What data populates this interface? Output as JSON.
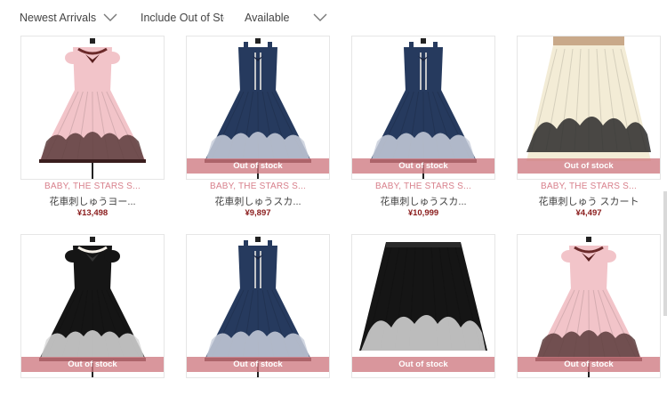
{
  "filters": [
    {
      "label": "Newest Arrivals",
      "has_chevron": true
    },
    {
      "label": "Include Out of Sto",
      "has_chevron": false
    },
    {
      "label": "Available",
      "has_chevron": true
    }
  ],
  "oos_label": "Out of stock",
  "products": [
    {
      "brand": "BABY, THE STARS S...",
      "name": "花車刺しゅうヨー...",
      "price": "¥13,498",
      "out_of_stock": false,
      "item": "pink-dress-icon"
    },
    {
      "brand": "BABY, THE STARS S...",
      "name": "花車刺しゅうスカ...",
      "price": "¥9,897",
      "out_of_stock": true,
      "item": "navy-dress-icon"
    },
    {
      "brand": "BABY, THE STARS S...",
      "name": "花車刺しゅうスカ...",
      "price": "¥10,999",
      "out_of_stock": true,
      "item": "navy-dress-icon"
    },
    {
      "brand": "BABY, THE STARS S...",
      "name": "花車刺しゅう スカート",
      "price": "¥4,497",
      "out_of_stock": true,
      "item": "cream-skirt-icon"
    },
    {
      "brand": "",
      "name": "",
      "price": "",
      "out_of_stock": true,
      "item": "black-dress-icon"
    },
    {
      "brand": "",
      "name": "",
      "price": "",
      "out_of_stock": true,
      "item": "navy-dress-icon"
    },
    {
      "brand": "",
      "name": "",
      "price": "",
      "out_of_stock": true,
      "item": "black-skirt-icon"
    },
    {
      "brand": "",
      "name": "",
      "price": "",
      "out_of_stock": true,
      "item": "pink-dress-icon"
    }
  ],
  "colors": {
    "brand": "#d8808c",
    "price": "#8a1c1c",
    "oos_band": "#ce7880",
    "pink": "#f2c4c9",
    "navy": "#263a5e",
    "cream": "#f3ecd6",
    "black": "#151515"
  }
}
